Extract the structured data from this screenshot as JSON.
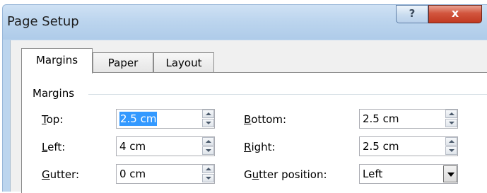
{
  "window": {
    "title": "Page Setup",
    "help_glyph": "?",
    "close_glyph": "x"
  },
  "tabs": [
    "Margins",
    "Paper",
    "Layout"
  ],
  "margins": {
    "group_title": "Margins",
    "top": {
      "label": "Top:",
      "value": "2.5 cm"
    },
    "bottom": {
      "label": "Bottom:",
      "value": "2.5 cm"
    },
    "left": {
      "label": "Left:",
      "value": "4 cm"
    },
    "right": {
      "label": "Right:",
      "value": "2.5 cm"
    },
    "gutter": {
      "label": "Gutter:",
      "value": "0 cm"
    },
    "gutter_position": {
      "label": "Gutter position:",
      "value": "Left"
    }
  }
}
